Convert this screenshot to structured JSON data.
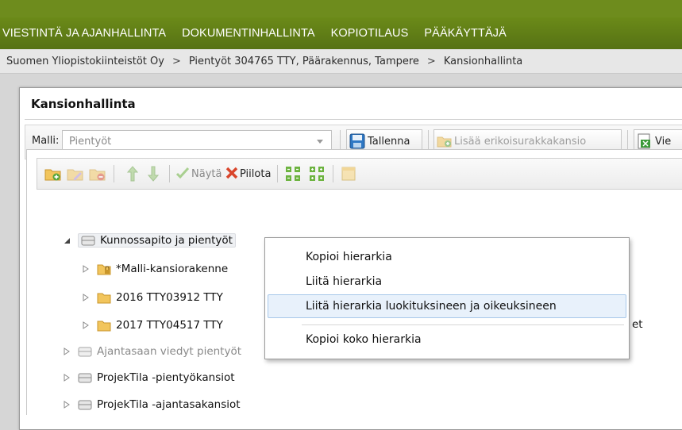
{
  "topnav": {
    "items": [
      {
        "label": "VIESTINTÄ JA AJANHALLINTA"
      },
      {
        "label": "DOKUMENTINHALLINTA"
      },
      {
        "label": "KOPIOTILAUS"
      },
      {
        "label": "PÄÄKÄYTTÄJÄ"
      }
    ]
  },
  "breadcrumb": {
    "items": [
      "Suomen Yliopistokiinteistöt Oy",
      "Pientyöt 304765 TTY, Päärakennus, Tampere",
      "Kansionhallinta"
    ],
    "separator": ">"
  },
  "panel": {
    "title": "Kansionhallinta",
    "malli_label": "Malli:",
    "malli_value": "Pientyöt",
    "save_label": "Tallenna",
    "add_special_label": "Lisää erikoisurakkakansio",
    "next_button_label": "Vie"
  },
  "tree_toolbar": {
    "show_label": "Näytä",
    "hide_label": "Piilota"
  },
  "tree": {
    "items": [
      {
        "label": "Kunnossapito ja pientyöt",
        "expanded": true
      },
      {
        "label": "*Malli-kansiorakenne"
      },
      {
        "label": "2016 TTY03912 TTY"
      },
      {
        "label": "2017 TTY04517 TTY"
      },
      {
        "label": "Ajantasaan viedyt pientyöt"
      },
      {
        "label": "ProjekTila -pientyökansiot"
      },
      {
        "label": "ProjekTila -ajantasakansiot"
      }
    ],
    "overflow_text": "et"
  },
  "context_menu": {
    "items": [
      {
        "label": "Kopioi hierarkia"
      },
      {
        "label": "Liitä hierarkia"
      },
      {
        "label": "Liitä hierarkia luokituksineen ja oikeuksineen",
        "hover": true
      },
      {
        "label": "Kopioi koko hierarkia"
      }
    ]
  },
  "colors": {
    "nav_green": "#6b8a18",
    "menu_hover": "#e8f1fb",
    "show_check": "#6cb33f",
    "hide_x": "#d9452b"
  }
}
